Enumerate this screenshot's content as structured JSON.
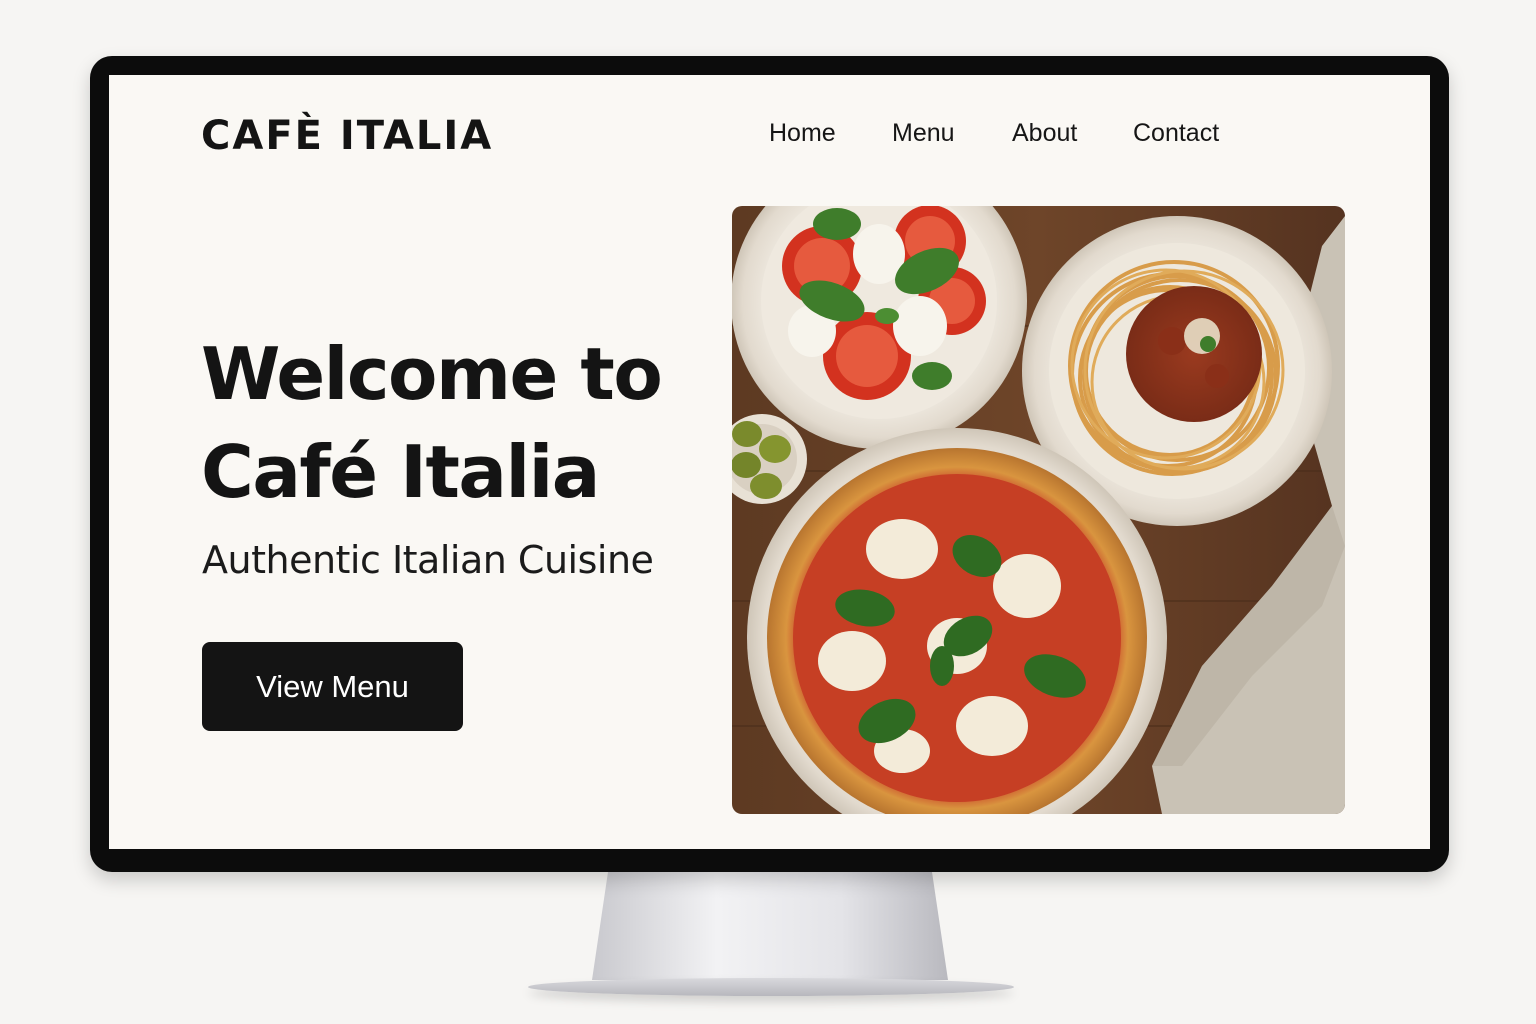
{
  "site": {
    "logo": "CAFÈ ITALIA"
  },
  "nav": {
    "items": [
      {
        "label": "Home"
      },
      {
        "label": "Menu"
      },
      {
        "label": "About"
      },
      {
        "label": "Contact"
      }
    ]
  },
  "hero": {
    "title_line1": "Welcome to",
    "title_line2": "Café Italia",
    "subtitle": "Authentic Italian Cuisine",
    "cta_label": "View Menu"
  },
  "colors": {
    "page_background": "#faf8f4",
    "text": "#141414",
    "button": "#141414",
    "button_text": "#ffffff",
    "bezel": "#0c0c0c"
  },
  "image": {
    "subject": "food-photo",
    "icons": [
      "caprese-salad-icon",
      "spaghetti-bolognese-icon",
      "margherita-pizza-icon",
      "olives-icon",
      "napkin-icon"
    ]
  }
}
